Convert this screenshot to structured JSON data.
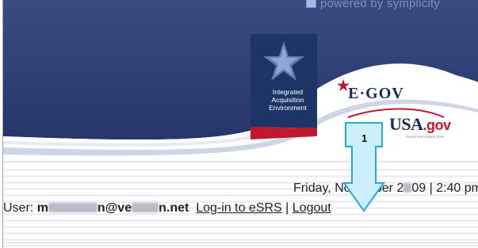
{
  "banner": {
    "powered_by": "powered by symplicity",
    "iae_line1": "Integrated",
    "iae_line2": "Acquisition",
    "iae_line3": "Environment",
    "egov": "E·GOV",
    "usagov_main": "USA",
    "usagov_tld": ".gov",
    "usagov_sub": "Government Made Easy"
  },
  "info": {
    "date": "Friday, November 2",
    "date_tail": "09 | 2:40 pm",
    "user_label": "User:",
    "email_start": "m",
    "email_mid": "n@ve",
    "email_end": "n.net",
    "login_link": "Log-in to eSRS",
    "separator": "|",
    "logout_link": "Logout"
  },
  "callout": {
    "number": "1"
  },
  "colors": {
    "banner_navy": "#2e3f73",
    "accent_red": "#c0182e",
    "callout_fill": "#cdeffb",
    "callout_stroke": "#2aa9d6"
  }
}
